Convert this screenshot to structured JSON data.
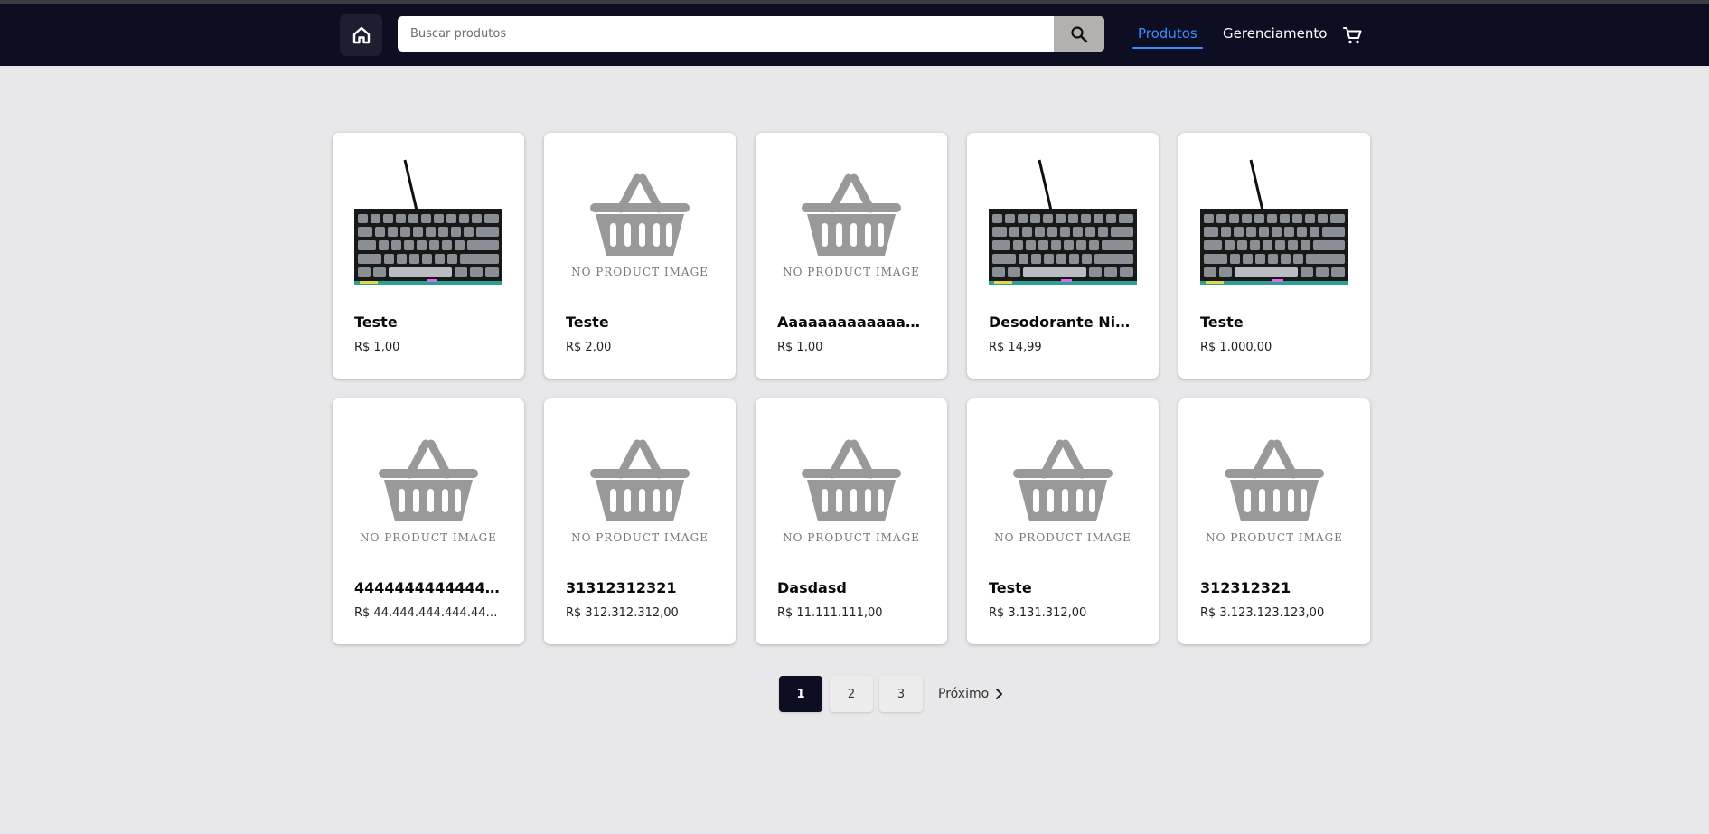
{
  "colors": {
    "header_bg": "#0d0e21",
    "page_bg": "#e8e8ea",
    "accent": "#3b8cff",
    "search_button_bg": "#b3b0ae",
    "pagination_active_bg": "#0d0e21"
  },
  "header": {
    "home_icon": "home-icon",
    "search": {
      "placeholder": "Buscar produtos",
      "value": "",
      "button_icon": "search-icon"
    },
    "nav": {
      "products_label": "Produtos",
      "management_label": "Gerenciamento"
    },
    "cart_icon": "shopping-cart-icon"
  },
  "products": [
    {
      "name": "Teste",
      "price": "R$ 1,00",
      "image": "keyboard-photo"
    },
    {
      "name": "Teste",
      "price": "R$ 2,00",
      "image": "no-product-image",
      "placeholder_text": "NO PRODUCT IMAGE"
    },
    {
      "name": "Aaaaaaaaaaaaaaa...",
      "price": "R$ 1,00",
      "image": "no-product-image",
      "placeholder_text": "NO PRODUCT IMAGE"
    },
    {
      "name": "Desodorante Nive...",
      "price": "R$ 14,99",
      "image": "keyboard-photo"
    },
    {
      "name": "Teste",
      "price": "R$ 1.000,00",
      "image": "keyboard-photo"
    },
    {
      "name": "4444444444444444",
      "price": "R$ 44.444.444.444.444...",
      "image": "no-product-image",
      "placeholder_text": "NO PRODUCT IMAGE"
    },
    {
      "name": "31312312321",
      "price": "R$ 312.312.312,00",
      "image": "no-product-image",
      "placeholder_text": "NO PRODUCT IMAGE"
    },
    {
      "name": "Dasdasd",
      "price": "R$ 11.111.111,00",
      "image": "no-product-image",
      "placeholder_text": "NO PRODUCT IMAGE"
    },
    {
      "name": "Teste",
      "price": "R$ 3.131.312,00",
      "image": "no-product-image",
      "placeholder_text": "NO PRODUCT IMAGE"
    },
    {
      "name": "312312321",
      "price": "R$ 3.123.123.123,00",
      "image": "no-product-image",
      "placeholder_text": "NO PRODUCT IMAGE"
    }
  ],
  "pagination": {
    "pages": [
      "1",
      "2",
      "3"
    ],
    "current": "1",
    "next_label": "Próximo",
    "next_icon": "chevron-right-icon"
  }
}
